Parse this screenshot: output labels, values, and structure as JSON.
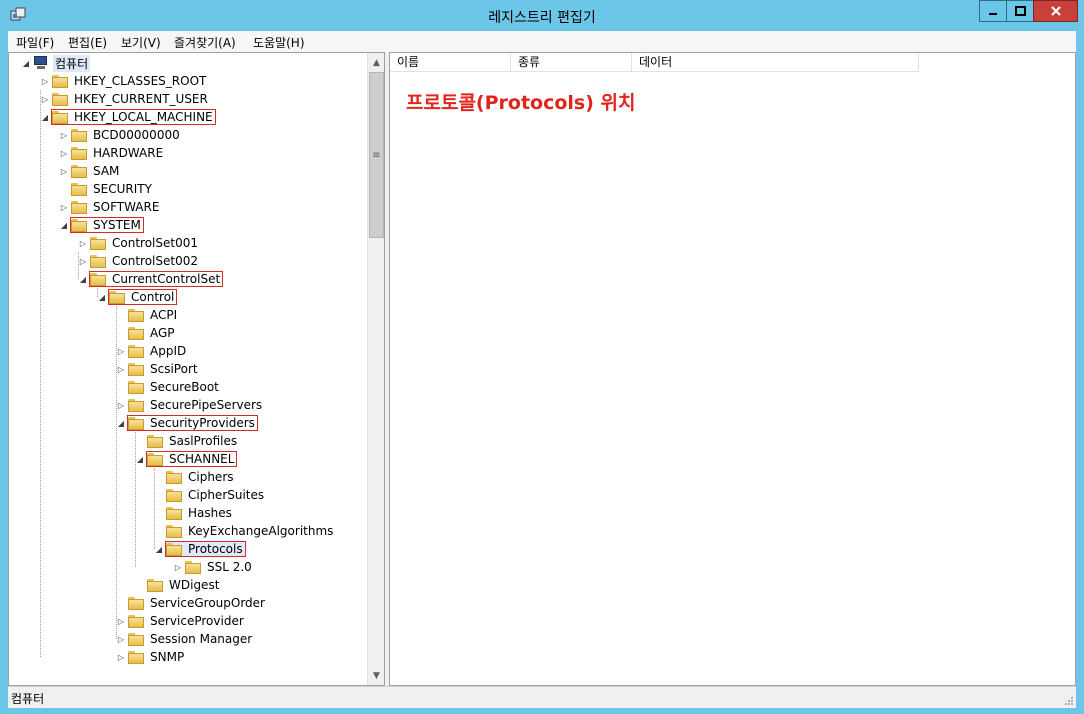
{
  "window": {
    "title": "레지스트리 편집기"
  },
  "menu": [
    "파일(F)",
    "편집(E)",
    "보기(V)",
    "즐겨찾기(A)",
    "도움말(H)"
  ],
  "tree": {
    "root": "컴퓨터",
    "items": [
      {
        "label": "HKEY_CLASSES_ROOT",
        "expander": "▷"
      },
      {
        "label": "HKEY_CURRENT_USER",
        "expander": "▷"
      },
      {
        "label": "HKEY_LOCAL_MACHINE",
        "expander": "◢"
      },
      {
        "label": "BCD00000000",
        "expander": "▷"
      },
      {
        "label": "HARDWARE",
        "expander": "▷"
      },
      {
        "label": "SAM",
        "expander": "▷"
      },
      {
        "label": "SECURITY",
        "expander": ""
      },
      {
        "label": "SOFTWARE",
        "expander": "▷"
      },
      {
        "label": "SYSTEM",
        "expander": "◢"
      },
      {
        "label": "ControlSet001",
        "expander": "▷"
      },
      {
        "label": "ControlSet002",
        "expander": "▷"
      },
      {
        "label": "CurrentControlSet",
        "expander": "◢"
      },
      {
        "label": "Control",
        "expander": "◢"
      },
      {
        "label": "ACPI",
        "expander": ""
      },
      {
        "label": "AGP",
        "expander": ""
      },
      {
        "label": "AppID",
        "expander": "▷"
      },
      {
        "label": "ScsiPort",
        "expander": "▷"
      },
      {
        "label": "SecureBoot",
        "expander": ""
      },
      {
        "label": "SecurePipeServers",
        "expander": "▷"
      },
      {
        "label": "SecurityProviders",
        "expander": "◢"
      },
      {
        "label": "SaslProfiles",
        "expander": ""
      },
      {
        "label": "SCHANNEL",
        "expander": "◢"
      },
      {
        "label": "Ciphers",
        "expander": ""
      },
      {
        "label": "CipherSuites",
        "expander": ""
      },
      {
        "label": "Hashes",
        "expander": ""
      },
      {
        "label": "KeyExchangeAlgorithms",
        "expander": ""
      },
      {
        "label": "Protocols",
        "expander": "◢"
      },
      {
        "label": "SSL 2.0",
        "expander": "▷"
      },
      {
        "label": "WDigest",
        "expander": ""
      },
      {
        "label": "ServiceGroupOrder",
        "expander": ""
      },
      {
        "label": "ServiceProvider",
        "expander": "▷"
      },
      {
        "label": "Session Manager",
        "expander": "▷"
      },
      {
        "label": "SNMP",
        "expander": "▷"
      }
    ]
  },
  "columns": [
    "이름",
    "종류",
    "데이터"
  ],
  "annotation": "프로토콜(Protocols) 위치",
  "status": "컴퓨터",
  "colors": {
    "titlebar": "#6cc6e7",
    "highlight": "#d42a2a",
    "annotation": "#e0261c"
  }
}
